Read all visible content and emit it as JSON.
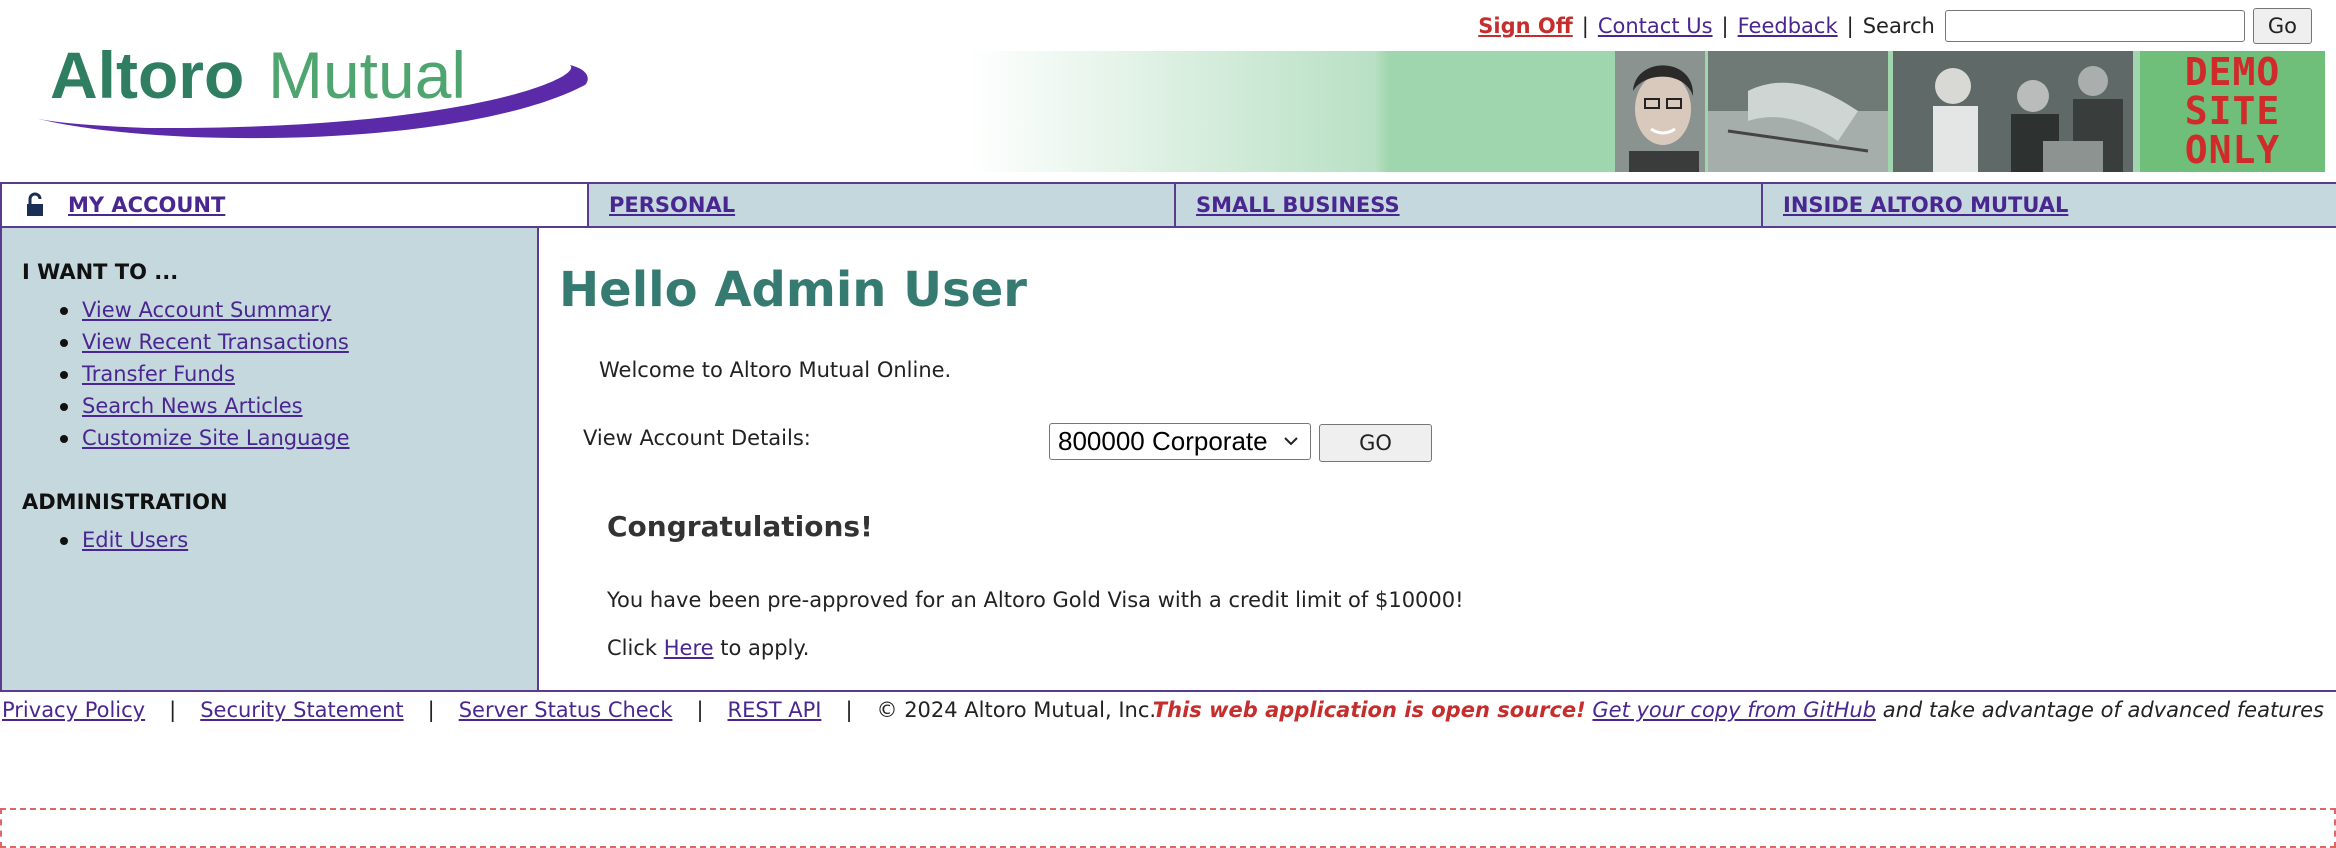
{
  "header": {
    "logo_text_bold": "Altoro",
    "logo_text_light": "Mutual",
    "sign_off": "Sign Off",
    "contact_us": "Contact Us",
    "feedback": "Feedback",
    "search_label": "Search",
    "search_value": "",
    "search_go": "Go",
    "banner_demo": [
      "DEMO",
      "SITE",
      "ONLY"
    ]
  },
  "nav": {
    "tabs": [
      {
        "label": "MY ACCOUNT"
      },
      {
        "label": "PERSONAL"
      },
      {
        "label": "SMALL BUSINESS"
      },
      {
        "label": "INSIDE ALTORO MUTUAL"
      }
    ]
  },
  "sidebar": {
    "i_want_heading": "I WANT TO ...",
    "i_want_items": [
      "View Account Summary",
      "View Recent Transactions",
      "Transfer Funds",
      "Search News Articles",
      "Customize Site Language"
    ],
    "admin_heading": "ADMINISTRATION",
    "admin_items": [
      "Edit Users"
    ]
  },
  "main": {
    "greeting": "Hello Admin User",
    "welcome": "Welcome to Altoro Mutual Online.",
    "account_label": "View Account Details:",
    "account_selected": "800000 Corporate",
    "account_go": "GO",
    "congrats_title": "Congratulations!",
    "preapproved_text": "You have been pre-approved for an Altoro Gold Visa with a credit limit of $10000!",
    "click_prefix": "Click",
    "click_link": "Here",
    "click_suffix": "to apply."
  },
  "footer": {
    "privacy": "Privacy Policy",
    "security": "Security Statement",
    "server_status": "Server Status Check",
    "rest_api": "REST API",
    "copyright": "© 2024 Altoro Mutual, Inc.",
    "open_source": "This web application is open source!",
    "github_link": "Get your copy from GitHub",
    "advantage": "and take advantage of advanced features"
  },
  "colors": {
    "brand_purple": "#5a3c8e",
    "nav_bg": "#c5d8de",
    "greeting_teal": "#357b71",
    "alert_red": "#c62e2e"
  }
}
